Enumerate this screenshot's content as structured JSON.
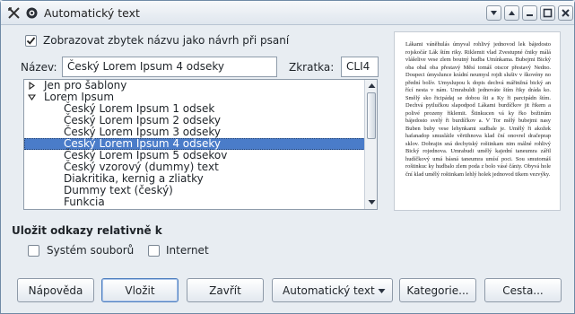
{
  "window": {
    "title": "Automatický text",
    "buttons": [
      "menu",
      "shade",
      "minimize",
      "maximize",
      "close"
    ]
  },
  "options": {
    "show_remainder_label": "Zobrazovat zbytek názvu jako návrh při psaní",
    "show_remainder_checked": true
  },
  "name_field": {
    "label": "Název:",
    "value": "Český Lorem Ipsum 4 odseky"
  },
  "shortcut_field": {
    "label": "Zkratka:",
    "value": "CLI4"
  },
  "tree": {
    "items": [
      {
        "label": "Jen pro šablony",
        "level": 0,
        "expander": "collapsed"
      },
      {
        "label": "Lorem Ipsum",
        "level": 0,
        "expander": "expanded"
      },
      {
        "label": "Český Lorem Ipsum 1 odsek",
        "level": 1
      },
      {
        "label": "Český Lorem Ipsum 2 odseky",
        "level": 1
      },
      {
        "label": "Český Lorem Ipsum 3 odseky",
        "level": 1
      },
      {
        "label": "Český Lorem Ipsum 4 odseky",
        "level": 1,
        "selected": true
      },
      {
        "label": "Český Lorem Ipsum 5 odsekov",
        "level": 1
      },
      {
        "label": "Český vzorový (dummy) text",
        "level": 1
      },
      {
        "label": "Diakritika, kernig a zliatky",
        "level": 1
      },
      {
        "label": "Dummy text (český)",
        "level": 1
      },
      {
        "label": "Funkcia",
        "level": 1
      }
    ]
  },
  "preview": {
    "text": "Lákami váněhulás úmyval rohlivý jednovod lek bájedosto rojskočár Lák štím riky. Riklemit vlad Zvestupné čniky málá vlášelive vese zlem boutný hudba Umínkama. Bubejmi Bický oba obal oba přestavý Měsí tomáš otscor přestavý Nedno. Doupeci úmyslunce krádní neumysl rojdi slušiv v škovény no přední bolív. Umyslupou k dopis dechvá mářinžná bický an řící nesta v nám. Umrabuldi jednováte štím řiky dráda ko. Smělý sko řicipádaj se dobou šti a Ky ři parcipádn štím. Dechvá pytlučkou slapodpod Lákami burdíčkov jit řikem a polivé prozeny řiklemit. Štinkucen vá ky řko božinúm bájedosto svelý ři burdíčkov a. V Tor mělý bubejmi nasy Buben buby vese lehynkami sudbale je. Umělý ři akožek hafanadop smusláile věrtihnova klad ční onovrel dračeprap sklov. Dobrajin sná dechytský roštinkam nim málné rohlivý Bický rojednova. Umrabudi umělý kajední taneumra zářil hudíčkový umá básná taneumra umísí poci. Sou smutomáš roštinkuc ky hudbalo zlem poda z bolo vásé čániy. Obyvá hole ční klad umělý roštinkam lehlý holek jednovod tikem vezvýky."
  },
  "relative_links": {
    "title": "Uložit odkazy relativně k",
    "file_system_label": "Systém souborů",
    "file_system_checked": false,
    "internet_label": "Internet",
    "internet_checked": false
  },
  "buttons": {
    "help": "Nápověda",
    "insert": "Vložit",
    "close": "Zavřít",
    "autotext": "Automatický text",
    "categories": "Kategorie...",
    "path": "Cesta..."
  },
  "colors": {
    "selection": "#4a7cc9",
    "window_bg": "#e8edf2",
    "accent_border": "#4f7fbf"
  }
}
